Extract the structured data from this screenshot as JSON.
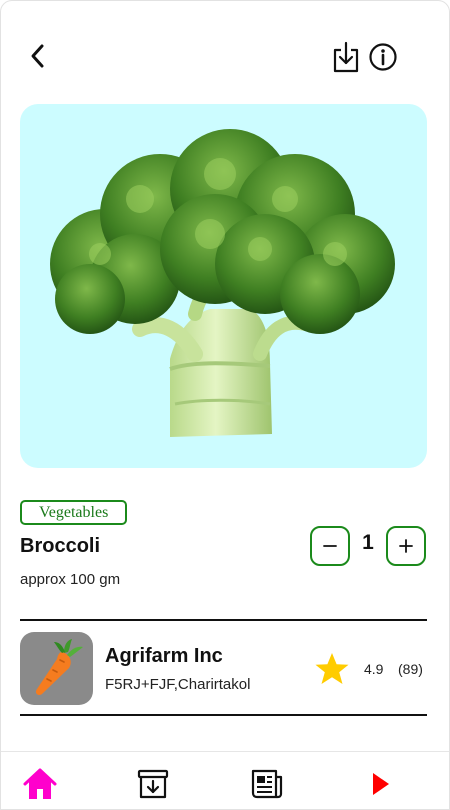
{
  "product": {
    "category": "Vegetables",
    "name": "Broccoli",
    "weight": "approx 100 gm",
    "quantity": "1",
    "image": "broccoli-image",
    "hero_bg": "#ccfcff"
  },
  "seller": {
    "name": "Agrifarm Inc",
    "address": "F5RJ+FJF,Charirtakol",
    "rating": "4.9",
    "reviews": "(89)",
    "logo": "carrot-logo"
  },
  "header": {
    "back_icon": "chevron-left-icon",
    "download_icon": "download-icon",
    "info_icon": "info-icon"
  },
  "nav": {
    "items": [
      {
        "icon": "home-icon",
        "active": true
      },
      {
        "icon": "archive-download-icon",
        "active": false
      },
      {
        "icon": "newspaper-icon",
        "active": false
      },
      {
        "icon": "play-icon",
        "active": false
      }
    ]
  },
  "colors": {
    "accent_green": "#1b8a1b",
    "active_nav": "#ff00cc",
    "star": "#ffcc00",
    "play": "#ff0000"
  }
}
